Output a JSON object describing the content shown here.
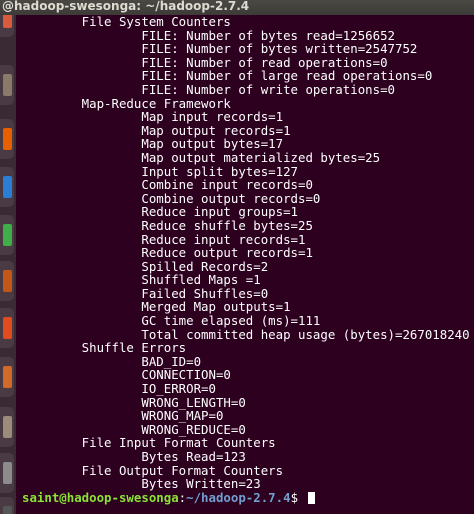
{
  "window": {
    "title": "@hadoop-swesonga: ~/hadoop-2.7.4"
  },
  "launcher": {
    "items": [
      {
        "name": "ubuntu-software-icon",
        "color": "#d85b3e"
      },
      {
        "name": "files-icon",
        "color": "#8a7a6a"
      },
      {
        "name": "firefox-icon",
        "color": "#e66000"
      },
      {
        "name": "writer-icon",
        "color": "#2a7fd4"
      },
      {
        "name": "calc-icon",
        "color": "#3fae49"
      },
      {
        "name": "impress-icon",
        "color": "#c2571a"
      },
      {
        "name": "app-icon",
        "color": "#e24b1f"
      },
      {
        "name": "software-center-icon",
        "color": "#cf6a2a"
      },
      {
        "name": "amazon-icon",
        "color": "#9b8b7a"
      },
      {
        "name": "settings-icon",
        "color": "#8c8c8c"
      },
      {
        "name": "terminal-icon",
        "color": "#555555"
      }
    ]
  },
  "terminal": {
    "lines": [
      "        File System Counters",
      "                FILE: Number of bytes read=1256652",
      "                FILE: Number of bytes written=2547752",
      "                FILE: Number of read operations=0",
      "                FILE: Number of large read operations=0",
      "                FILE: Number of write operations=0",
      "        Map-Reduce Framework",
      "                Map input records=1",
      "                Map output records=1",
      "                Map output bytes=17",
      "                Map output materialized bytes=25",
      "                Input split bytes=127",
      "                Combine input records=0",
      "                Combine output records=0",
      "                Reduce input groups=1",
      "                Reduce shuffle bytes=25",
      "                Reduce input records=1",
      "                Reduce output records=1",
      "                Spilled Records=2",
      "                Shuffled Maps =1",
      "                Failed Shuffles=0",
      "                Merged Map outputs=1",
      "                GC time elapsed (ms)=111",
      "                Total committed heap usage (bytes)=267018240",
      "        Shuffle Errors",
      "                BAD_ID=0",
      "                CONNECTION=0",
      "                IO_ERROR=0",
      "                WRONG_LENGTH=0",
      "                WRONG_MAP=0",
      "                WRONG_REDUCE=0",
      "        File Input Format Counters",
      "                Bytes Read=123",
      "        File Output Format Counters",
      "                Bytes Written=23"
    ],
    "prompt": {
      "user_host": "saint@hadoop-swesonga",
      "separator": ":",
      "path": "~/hadoop-2.7.4",
      "symbol": "$ "
    }
  }
}
